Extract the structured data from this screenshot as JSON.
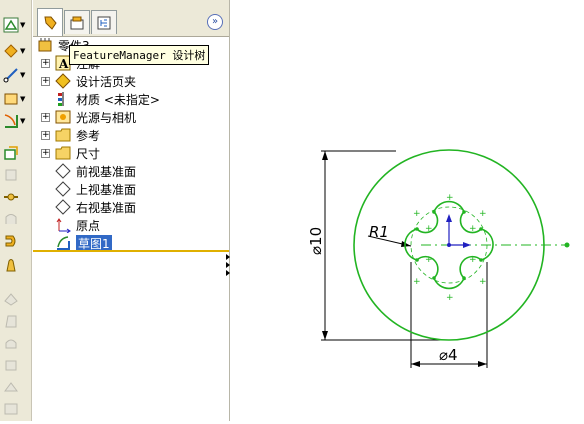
{
  "command_bar": {
    "tools": [
      {
        "icon": "sketch-icon"
      },
      {
        "icon": "smart-dimension-icon"
      },
      {
        "icon": "line-icon"
      },
      {
        "icon": "rectangle-icon"
      },
      {
        "icon": "fillet-icon"
      },
      {
        "icon": "extrude-icon"
      },
      {
        "icon": "revolve-icon"
      },
      {
        "icon": "sweep-icon"
      },
      {
        "icon": "loft-icon"
      },
      {
        "icon": "hole-icon"
      },
      {
        "icon": "shell-icon"
      },
      {
        "icon": "rib-icon"
      },
      {
        "icon": "draft-icon"
      },
      {
        "icon": "dome-icon"
      },
      {
        "icon": "wrap-icon"
      },
      {
        "icon": "mirror-icon"
      }
    ]
  },
  "feature_manager": {
    "tabs": [
      {
        "icon": "feature-manager-tab-icon"
      },
      {
        "icon": "property-manager-tab-icon"
      },
      {
        "icon": "configuration-manager-tab-icon"
      }
    ],
    "expand_label": "»",
    "root_label": "零件3",
    "tooltip": "FeatureManager 设计树",
    "items": [
      {
        "label": "注解",
        "icon": "annotations-icon",
        "expandable": true
      },
      {
        "label": "设计活页夹",
        "icon": "design-binder-icon",
        "expandable": true
      },
      {
        "label": "材质 <未指定>",
        "icon": "material-icon",
        "expandable": false
      },
      {
        "label": "光源与相机",
        "icon": "lights-cameras-icon",
        "expandable": true
      },
      {
        "label": "参考",
        "icon": "folder-icon",
        "expandable": true
      },
      {
        "label": "尺寸",
        "icon": "folder-icon",
        "expandable": true
      },
      {
        "label": "前视基准面",
        "icon": "plane-icon",
        "expandable": false
      },
      {
        "label": "上视基准面",
        "icon": "plane-icon",
        "expandable": false
      },
      {
        "label": "右视基准面",
        "icon": "plane-icon",
        "expandable": false
      },
      {
        "label": "原点",
        "icon": "origin-icon",
        "expandable": false
      },
      {
        "label": "草图1",
        "icon": "sketch-icon",
        "expandable": false,
        "selected": true
      }
    ]
  },
  "graphics": {
    "dimensions": {
      "outer_diameter": "⌀10",
      "inner_diameter": "⌀4",
      "fillet_radius": "R1"
    },
    "colors": {
      "sketch": "#22b422",
      "dimension": "#000000",
      "constraint": "#008000",
      "origin_x": "#2020c0",
      "origin_y": "#c02020"
    }
  }
}
